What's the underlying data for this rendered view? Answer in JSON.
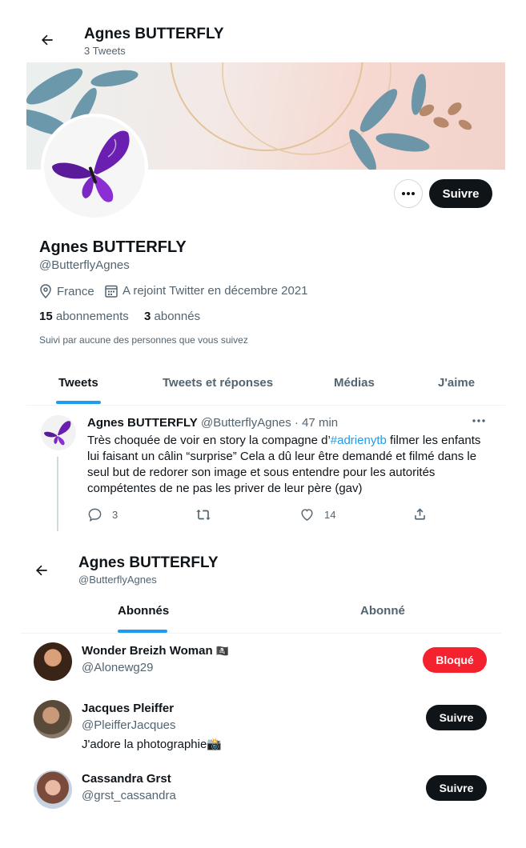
{
  "profile": {
    "header_name": "Agnes BUTTERFLY",
    "tweet_count": "3 Tweets",
    "name": "Agnes BUTTERFLY",
    "handle": "@ButterflyAgnes",
    "location": "France",
    "joined": "A rejoint Twitter en décembre 2021",
    "following_count": "15",
    "following_label": "abonnements",
    "followers_count": "3",
    "followers_label": "abonnés",
    "followed_by": "Suivi par aucune des personnes que vous suivez",
    "follow_label": "Suivre"
  },
  "tabs": [
    "Tweets",
    "Tweets et réponses",
    "Médias",
    "J'aime"
  ],
  "tweet": {
    "name": "Agnes BUTTERFLY",
    "handle": "@ButterflyAgnes",
    "sep": "·",
    "time": "47 min",
    "text_before": "Très choquée de voir en story la compagne d’",
    "hashtag": "#adrienytb",
    "text_after": " filmer les enfants lui faisant un câlin “surprise” Cela a dû leur être demandé et filmé dans le seul but de redorer son image et sous entendre pour les autorités compétentes de ne pas les priver de leur père (gav)",
    "replies": "3",
    "likes": "14"
  },
  "followers_page": {
    "title": "Agnes BUTTERFLY",
    "handle": "@ButterflyAgnes",
    "tabs": [
      "Abonnés",
      "Abonné"
    ],
    "users": [
      {
        "name": "Wonder Breizh Woman",
        "emoji": "🏴‍☠️",
        "handle": "@Alonewg29",
        "bio": "",
        "button": "Bloqué"
      },
      {
        "name": "Jacques Pleiffer",
        "emoji": "",
        "handle": "@PleifferJacques",
        "bio": "J'adore la photographie📸",
        "button": "Suivre"
      },
      {
        "name": "Cassandra Grst",
        "emoji": "",
        "handle": "@grst_cassandra",
        "bio": "",
        "button": "Suivre"
      }
    ]
  },
  "colors": {
    "accent": "#1d9bf0",
    "blocked": "#f4212e",
    "dark": "#0f1419",
    "muted": "#536471"
  }
}
